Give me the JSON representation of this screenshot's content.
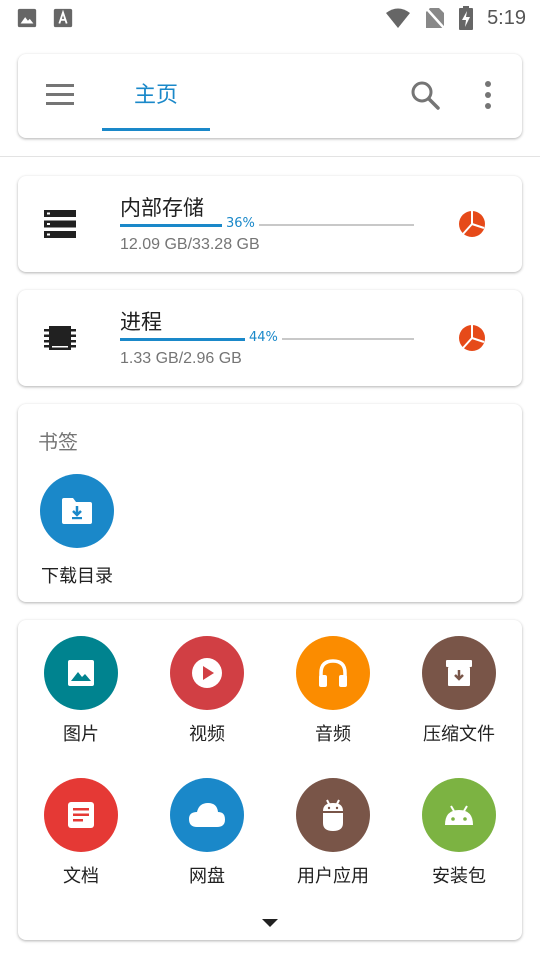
{
  "status_bar": {
    "time": "5:19",
    "left_icons": [
      "image-icon",
      "text-a-icon"
    ],
    "right_icons": [
      "wifi-icon",
      "no-sim-icon",
      "battery-charging-icon"
    ]
  },
  "toolbar": {
    "tab_label": "主页",
    "icons": [
      "menu-icon",
      "search-icon",
      "more-vert-icon"
    ]
  },
  "storage": [
    {
      "title": "内部存储",
      "percent": 36,
      "percent_label": "36%",
      "usage": "12.09 GB/33.28 GB",
      "icon": "storage-icon"
    },
    {
      "title": "进程",
      "percent": 44,
      "percent_label": "44%",
      "usage": "1.33 GB/2.96 GB",
      "icon": "memory-chip-icon"
    }
  ],
  "bookmarks": {
    "title": "书签",
    "items": [
      {
        "label": "下载目录",
        "icon": "download-folder-icon",
        "color": "#1a88c9"
      }
    ]
  },
  "categories": [
    {
      "label": "图片",
      "icon": "image-icon",
      "color": "#00838f"
    },
    {
      "label": "视频",
      "icon": "play-icon",
      "color": "#d13f44"
    },
    {
      "label": "音频",
      "icon": "headphones-icon",
      "color": "#fb8c00"
    },
    {
      "label": "压缩文件",
      "icon": "archive-icon",
      "color": "#795548"
    },
    {
      "label": "文档",
      "icon": "document-icon",
      "color": "#e53935"
    },
    {
      "label": "网盘",
      "icon": "cloud-icon",
      "color": "#1a88c9"
    },
    {
      "label": "用户应用",
      "icon": "android-app-icon",
      "color": "#795548"
    },
    {
      "label": "安装包",
      "icon": "android-icon",
      "color": "#7cb342"
    }
  ],
  "colors": {
    "accent": "#1a88c9",
    "pie_icon": "#e64a19"
  }
}
